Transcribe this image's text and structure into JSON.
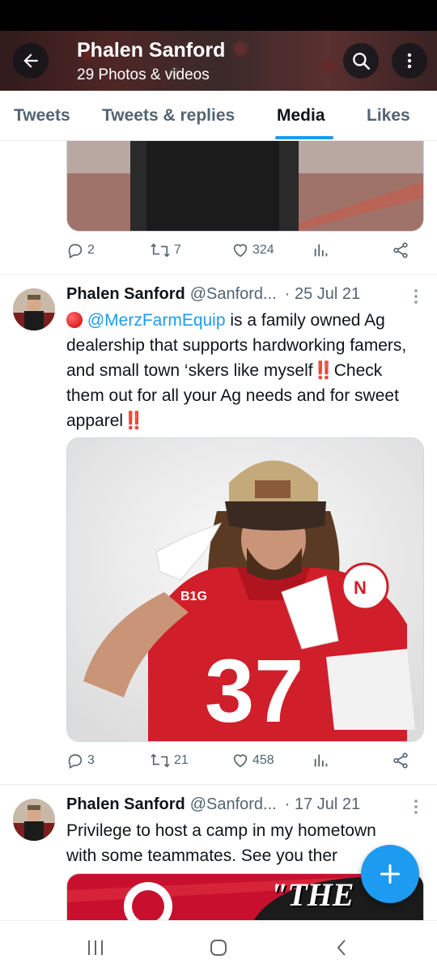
{
  "header": {
    "title": "Phalen Sanford",
    "subtitle": "29 Photos & videos"
  },
  "tabs": [
    {
      "label": "Tweets"
    },
    {
      "label": "Tweets & replies"
    },
    {
      "label": "Media"
    },
    {
      "label": "Likes"
    }
  ],
  "active_tab": "Media",
  "top_tweet": {
    "replies": "2",
    "retweets": "7",
    "likes": "324"
  },
  "tweet1": {
    "name": "Phalen Sanford",
    "handle": "@Sanford...",
    "date": "· 25 Jul 21",
    "mention": "@MerzFarmEquip",
    "text1": " is a family owned Ag dealership that supports hardworking famers, and small town ‘skers like myself",
    "bang": "‼️",
    "text2": "Check them out for all your Ag needs and for sweet apparel",
    "replies": "3",
    "retweets": "21",
    "likes": "458"
  },
  "tweet2": {
    "name": "Phalen Sanford",
    "handle": "@Sanford...",
    "date": "· 17 Jul 21",
    "text": "Privilege to host a camp in my hometown with some teammates. See you ther",
    "image_caption": "\"THE"
  },
  "icons": {
    "back": "arrow-left-icon",
    "search": "search-icon",
    "more": "more-vertical-icon",
    "reply": "reply-icon",
    "retweet": "retweet-icon",
    "like": "heart-icon",
    "views": "views-icon",
    "share": "share-icon",
    "compose": "plus-icon"
  },
  "colors": {
    "accent": "#1d9bf0",
    "text": "#0f1419",
    "muted": "#536471"
  }
}
